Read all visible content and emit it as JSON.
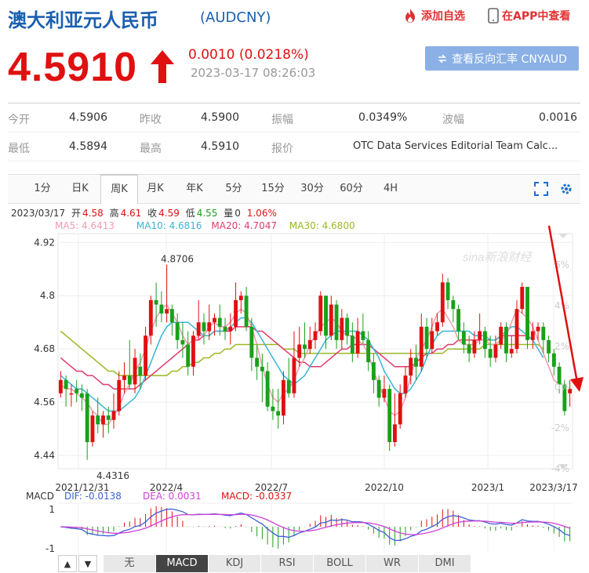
{
  "header": {
    "title": "澳大利亚元人民币",
    "code": "(AUDCNY)",
    "add_fav": "添加自选",
    "app_view": "在APP中查看",
    "price": "4.5910",
    "change": "0.0010 (0.0218%)",
    "time": "2023-03-17 08:26:03",
    "reverse_btn": "查看反向汇率 CNYAUD"
  },
  "info": {
    "row1": [
      {
        "label": "今开",
        "value": "4.5906"
      },
      {
        "label": "昨收",
        "value": "4.5900"
      },
      {
        "label": "振幅",
        "value": "0.0349%"
      },
      {
        "label": "波幅",
        "value": "0.0016"
      }
    ],
    "row2": [
      {
        "label": "最低",
        "value": "4.5894"
      },
      {
        "label": "最高",
        "value": "4.5910"
      },
      {
        "label": "报价",
        "value": "OTC Data Services Editorial Team Calc..."
      }
    ]
  },
  "tabs": [
    "1分",
    "日K",
    "周K",
    "月K",
    "年K",
    "5分",
    "15分",
    "30分",
    "60分",
    "4H"
  ],
  "active_tab": "周K",
  "legend": {
    "date": "2023/03/17",
    "open_label": "开",
    "open": "4.58",
    "high_label": "高",
    "high": "4.61",
    "close_label": "收",
    "close": "4.59",
    "low_label": "低",
    "low": "4.55",
    "vol_label": "量",
    "vol": "0",
    "pct": "1.06%",
    "ma5": "MA5: 4.6413",
    "ma10": "MA10: 4.6816",
    "ma20": "MA20: 4.7047",
    "ma30": "MA30: 4.6800"
  },
  "macd_legend": {
    "name": "MACD",
    "dif": "DIF: -0.0138",
    "dea": "DEA: 0.0031",
    "macd": "MACD: -0.0337"
  },
  "indicators": [
    "无",
    "MACD",
    "KDJ",
    "RSI",
    "BOLL",
    "WR",
    "DMI"
  ],
  "active_indicator": "MACD",
  "nav": {
    "up": "▲",
    "down": "▼"
  },
  "watermark": "sina新浪财经",
  "colors": {
    "up": "#e01010",
    "down": "#1aa01a",
    "ma5": "#f39ab0",
    "ma10": "#3ab4d8",
    "ma20": "#e03c6c",
    "ma30": "#9ab827",
    "dif": "#3b5fd6",
    "dea": "#d040d8"
  },
  "chart_data": {
    "type": "candlestick",
    "title": "",
    "y_ticks": [
      "4.92",
      "4.8",
      "4.68",
      "4.56",
      "4.44"
    ],
    "ylim": [
      4.41,
      4.94
    ],
    "pct_ticks": [
      "6%",
      "4%",
      "2%",
      "0%",
      "-2%",
      "-4%"
    ],
    "x_ticks": [
      "2021/12/31",
      "2022/4",
      "2022/7",
      "2022/10",
      "2023/1",
      "2023/3/17"
    ],
    "annotations": [
      {
        "text": "4.8706",
        "value": 4.8706
      },
      {
        "text": "4.4316",
        "value": 4.4316
      }
    ],
    "macd_y_ticks": [
      "1",
      "-1"
    ],
    "candles": [
      {
        "o": 4.58,
        "c": 4.61,
        "h": 4.63,
        "l": 4.57
      },
      {
        "o": 4.61,
        "c": 4.59,
        "h": 4.62,
        "l": 4.55
      },
      {
        "o": 4.58,
        "c": 4.58,
        "h": 4.6,
        "l": 4.55
      },
      {
        "o": 4.59,
        "c": 4.58,
        "h": 4.61,
        "l": 4.56
      },
      {
        "o": 4.58,
        "c": 4.57,
        "h": 4.6,
        "l": 4.54
      },
      {
        "o": 4.58,
        "c": 4.47,
        "h": 4.59,
        "l": 4.43
      },
      {
        "o": 4.47,
        "c": 4.53,
        "h": 4.54,
        "l": 4.46
      },
      {
        "o": 4.53,
        "c": 4.51,
        "h": 4.57,
        "l": 4.49
      },
      {
        "o": 4.51,
        "c": 4.53,
        "h": 4.54,
        "l": 4.48
      },
      {
        "o": 4.53,
        "c": 4.52,
        "h": 4.55,
        "l": 4.49
      },
      {
        "o": 4.52,
        "c": 4.54,
        "h": 4.58,
        "l": 4.5
      },
      {
        "o": 4.54,
        "c": 4.61,
        "h": 4.63,
        "l": 4.53
      },
      {
        "o": 4.61,
        "c": 4.62,
        "h": 4.65,
        "l": 4.58
      },
      {
        "o": 4.62,
        "c": 4.6,
        "h": 4.7,
        "l": 4.59
      },
      {
        "o": 4.6,
        "c": 4.66,
        "h": 4.68,
        "l": 4.58
      },
      {
        "o": 4.64,
        "c": 4.62,
        "h": 4.67,
        "l": 4.59
      },
      {
        "o": 4.62,
        "c": 4.71,
        "h": 4.73,
        "l": 4.61
      },
      {
        "o": 4.71,
        "c": 4.79,
        "h": 4.8,
        "l": 4.69
      },
      {
        "o": 4.79,
        "c": 4.78,
        "h": 4.83,
        "l": 4.73
      },
      {
        "o": 4.78,
        "c": 4.76,
        "h": 4.81,
        "l": 4.74
      },
      {
        "o": 4.76,
        "c": 4.77,
        "h": 4.87,
        "l": 4.74
      },
      {
        "o": 4.77,
        "c": 4.74,
        "h": 4.78,
        "l": 4.71
      },
      {
        "o": 4.74,
        "c": 4.7,
        "h": 4.76,
        "l": 4.68
      },
      {
        "o": 4.7,
        "c": 4.69,
        "h": 4.74,
        "l": 4.66
      },
      {
        "o": 4.69,
        "c": 4.64,
        "h": 4.72,
        "l": 4.62
      },
      {
        "o": 4.64,
        "c": 4.71,
        "h": 4.72,
        "l": 4.62
      },
      {
        "o": 4.71,
        "c": 4.74,
        "h": 4.79,
        "l": 4.7
      },
      {
        "o": 4.74,
        "c": 4.72,
        "h": 4.76,
        "l": 4.69
      },
      {
        "o": 4.72,
        "c": 4.74,
        "h": 4.78,
        "l": 4.7
      },
      {
        "o": 4.74,
        "c": 4.75,
        "h": 4.76,
        "l": 4.71
      },
      {
        "o": 4.75,
        "c": 4.73,
        "h": 4.78,
        "l": 4.71
      },
      {
        "o": 4.73,
        "c": 4.72,
        "h": 4.75,
        "l": 4.7
      },
      {
        "o": 4.72,
        "c": 4.73,
        "h": 4.76,
        "l": 4.69
      },
      {
        "o": 4.73,
        "c": 4.79,
        "h": 4.83,
        "l": 4.72
      },
      {
        "o": 4.79,
        "c": 4.8,
        "h": 4.81,
        "l": 4.76
      },
      {
        "o": 4.8,
        "c": 4.73,
        "h": 4.82,
        "l": 4.72
      },
      {
        "o": 4.73,
        "c": 4.66,
        "h": 4.75,
        "l": 4.63
      },
      {
        "o": 4.66,
        "c": 4.64,
        "h": 4.69,
        "l": 4.61
      },
      {
        "o": 4.64,
        "c": 4.63,
        "h": 4.67,
        "l": 4.56
      },
      {
        "o": 4.63,
        "c": 4.55,
        "h": 4.65,
        "l": 4.54
      },
      {
        "o": 4.55,
        "c": 4.54,
        "h": 4.59,
        "l": 4.52
      },
      {
        "o": 4.54,
        "c": 4.53,
        "h": 4.59,
        "l": 4.5
      },
      {
        "o": 4.53,
        "c": 4.61,
        "h": 4.63,
        "l": 4.51
      },
      {
        "o": 4.61,
        "c": 4.58,
        "h": 4.66,
        "l": 4.57
      },
      {
        "o": 4.58,
        "c": 4.66,
        "h": 4.72,
        "l": 4.57
      },
      {
        "o": 4.66,
        "c": 4.69,
        "h": 4.73,
        "l": 4.64
      },
      {
        "o": 4.69,
        "c": 4.68,
        "h": 4.74,
        "l": 4.66
      },
      {
        "o": 4.68,
        "c": 4.7,
        "h": 4.73,
        "l": 4.67
      },
      {
        "o": 4.7,
        "c": 4.72,
        "h": 4.74,
        "l": 4.68
      },
      {
        "o": 4.72,
        "c": 4.8,
        "h": 4.81,
        "l": 4.71
      },
      {
        "o": 4.8,
        "c": 4.71,
        "h": 4.8,
        "l": 4.68
      },
      {
        "o": 4.71,
        "c": 4.78,
        "h": 4.8,
        "l": 4.7
      },
      {
        "o": 4.78,
        "c": 4.7,
        "h": 4.79,
        "l": 4.68
      },
      {
        "o": 4.7,
        "c": 4.75,
        "h": 4.77,
        "l": 4.68
      },
      {
        "o": 4.75,
        "c": 4.71,
        "h": 4.76,
        "l": 4.69
      },
      {
        "o": 4.71,
        "c": 4.67,
        "h": 4.74,
        "l": 4.65
      },
      {
        "o": 4.67,
        "c": 4.72,
        "h": 4.75,
        "l": 4.66
      },
      {
        "o": 4.72,
        "c": 4.7,
        "h": 4.76,
        "l": 4.69
      },
      {
        "o": 4.7,
        "c": 4.65,
        "h": 4.72,
        "l": 4.63
      },
      {
        "o": 4.65,
        "c": 4.61,
        "h": 4.67,
        "l": 4.58
      },
      {
        "o": 4.61,
        "c": 4.57,
        "h": 4.62,
        "l": 4.55
      },
      {
        "o": 4.57,
        "c": 4.59,
        "h": 4.62,
        "l": 4.56
      },
      {
        "o": 4.59,
        "c": 4.47,
        "h": 4.6,
        "l": 4.45
      },
      {
        "o": 4.47,
        "c": 4.51,
        "h": 4.58,
        "l": 4.46
      },
      {
        "o": 4.51,
        "c": 4.58,
        "h": 4.6,
        "l": 4.5
      },
      {
        "o": 4.58,
        "c": 4.62,
        "h": 4.64,
        "l": 4.57
      },
      {
        "o": 4.62,
        "c": 4.66,
        "h": 4.68,
        "l": 4.6
      },
      {
        "o": 4.66,
        "c": 4.64,
        "h": 4.69,
        "l": 4.61
      },
      {
        "o": 4.64,
        "c": 4.73,
        "h": 4.76,
        "l": 4.63
      },
      {
        "o": 4.73,
        "c": 4.68,
        "h": 4.75,
        "l": 4.66
      },
      {
        "o": 4.68,
        "c": 4.72,
        "h": 4.75,
        "l": 4.67
      },
      {
        "o": 4.72,
        "c": 4.74,
        "h": 4.76,
        "l": 4.71
      },
      {
        "o": 4.74,
        "c": 4.83,
        "h": 4.85,
        "l": 4.73
      },
      {
        "o": 4.83,
        "c": 4.79,
        "h": 4.84,
        "l": 4.77
      },
      {
        "o": 4.79,
        "c": 4.77,
        "h": 4.8,
        "l": 4.74
      },
      {
        "o": 4.77,
        "c": 4.72,
        "h": 4.78,
        "l": 4.7
      },
      {
        "o": 4.72,
        "c": 4.69,
        "h": 4.74,
        "l": 4.67
      },
      {
        "o": 4.69,
        "c": 4.67,
        "h": 4.71,
        "l": 4.65
      },
      {
        "o": 4.67,
        "c": 4.7,
        "h": 4.72,
        "l": 4.66
      },
      {
        "o": 4.7,
        "c": 4.72,
        "h": 4.76,
        "l": 4.69
      },
      {
        "o": 4.72,
        "c": 4.68,
        "h": 4.73,
        "l": 4.66
      },
      {
        "o": 4.68,
        "c": 4.66,
        "h": 4.71,
        "l": 4.64
      },
      {
        "o": 4.66,
        "c": 4.69,
        "h": 4.71,
        "l": 4.65
      },
      {
        "o": 4.69,
        "c": 4.73,
        "h": 4.74,
        "l": 4.68
      },
      {
        "o": 4.73,
        "c": 4.67,
        "h": 4.74,
        "l": 4.65
      },
      {
        "o": 4.67,
        "c": 4.68,
        "h": 4.71,
        "l": 4.66
      },
      {
        "o": 4.68,
        "c": 4.77,
        "h": 4.79,
        "l": 4.67
      },
      {
        "o": 4.77,
        "c": 4.82,
        "h": 4.83,
        "l": 4.76
      },
      {
        "o": 4.82,
        "c": 4.7,
        "h": 4.82,
        "l": 4.68
      },
      {
        "o": 4.7,
        "c": 4.72,
        "h": 4.74,
        "l": 4.68
      },
      {
        "o": 4.72,
        "c": 4.73,
        "h": 4.74,
        "l": 4.7
      },
      {
        "o": 4.73,
        "c": 4.7,
        "h": 4.74,
        "l": 4.67
      },
      {
        "o": 4.7,
        "c": 4.67,
        "h": 4.71,
        "l": 4.65
      },
      {
        "o": 4.67,
        "c": 4.64,
        "h": 4.68,
        "l": 4.62
      },
      {
        "o": 4.64,
        "c": 4.6,
        "h": 4.65,
        "l": 4.58
      },
      {
        "o": 4.6,
        "c": 4.54,
        "h": 4.61,
        "l": 4.53
      },
      {
        "o": 4.58,
        "c": 4.59,
        "h": 4.61,
        "l": 4.55
      }
    ],
    "ma5": [
      4.6,
      4.59,
      4.59,
      4.58,
      4.57,
      4.56,
      4.54,
      4.53,
      4.51,
      4.51,
      4.53,
      4.55,
      4.58,
      4.6,
      4.63,
      4.65,
      4.68,
      4.72,
      4.75,
      4.77,
      4.78,
      4.76,
      4.74,
      4.71,
      4.69,
      4.7,
      4.71,
      4.71,
      4.73,
      4.74,
      4.73,
      4.73,
      4.74,
      4.76,
      4.77,
      4.76,
      4.73,
      4.69,
      4.64,
      4.6,
      4.57,
      4.56,
      4.58,
      4.59,
      4.61,
      4.64,
      4.66,
      4.69,
      4.71,
      4.73,
      4.74,
      4.75,
      4.74,
      4.72,
      4.71,
      4.71,
      4.7,
      4.69,
      4.67,
      4.63,
      4.6,
      4.57,
      4.54,
      4.53,
      4.54,
      4.57,
      4.62,
      4.66,
      4.68,
      4.7,
      4.73,
      4.76,
      4.77,
      4.75,
      4.73,
      4.7,
      4.69,
      4.69,
      4.69,
      4.7,
      4.7,
      4.69,
      4.69,
      4.7,
      4.71,
      4.74,
      4.77,
      4.76,
      4.75,
      4.73,
      4.7,
      4.67,
      4.64,
      4.61,
      4.6
    ],
    "ma10": [
      4.62,
      4.61,
      4.6,
      4.59,
      4.59,
      4.58,
      4.57,
      4.56,
      4.55,
      4.54,
      4.54,
      4.54,
      4.55,
      4.56,
      4.57,
      4.59,
      4.62,
      4.65,
      4.68,
      4.71,
      4.73,
      4.74,
      4.74,
      4.74,
      4.74,
      4.73,
      4.72,
      4.71,
      4.71,
      4.72,
      4.72,
      4.72,
      4.73,
      4.74,
      4.75,
      4.75,
      4.74,
      4.72,
      4.7,
      4.68,
      4.66,
      4.64,
      4.62,
      4.61,
      4.6,
      4.61,
      4.62,
      4.64,
      4.66,
      4.68,
      4.7,
      4.71,
      4.72,
      4.72,
      4.72,
      4.72,
      4.72,
      4.71,
      4.7,
      4.68,
      4.66,
      4.63,
      4.61,
      4.59,
      4.58,
      4.58,
      4.59,
      4.61,
      4.63,
      4.66,
      4.69,
      4.71,
      4.72,
      4.72,
      4.72,
      4.72,
      4.72,
      4.72,
      4.71,
      4.71,
      4.71,
      4.7,
      4.7,
      4.71,
      4.72,
      4.73,
      4.73,
      4.72,
      4.71,
      4.7,
      4.68,
      4.66
    ],
    "ma20": [
      4.66,
      4.65,
      4.64,
      4.63,
      4.63,
      4.62,
      4.62,
      4.61,
      4.6,
      4.6,
      4.59,
      4.59,
      4.59,
      4.59,
      4.59,
      4.6,
      4.61,
      4.62,
      4.63,
      4.64,
      4.65,
      4.66,
      4.67,
      4.68,
      4.69,
      4.7,
      4.7,
      4.71,
      4.71,
      4.72,
      4.72,
      4.72,
      4.72,
      4.73,
      4.73,
      4.73,
      4.73,
      4.72,
      4.72,
      4.71,
      4.7,
      4.69,
      4.68,
      4.67,
      4.66,
      4.65,
      4.65,
      4.64,
      4.64,
      4.64,
      4.65,
      4.66,
      4.67,
      4.68,
      4.68,
      4.69,
      4.69,
      4.69,
      4.69,
      4.68,
      4.67,
      4.66,
      4.65,
      4.64,
      4.64,
      4.64,
      4.64,
      4.65,
      4.66,
      4.67,
      4.67,
      4.68,
      4.68,
      4.69,
      4.69,
      4.7,
      4.7,
      4.7,
      4.7,
      4.7,
      4.7,
      4.7,
      4.7,
      4.71,
      4.71,
      4.71,
      4.71,
      4.71,
      4.71,
      4.7
    ],
    "ma30": [
      4.72,
      4.71,
      4.7,
      4.69,
      4.68,
      4.67,
      4.66,
      4.65,
      4.64,
      4.63,
      4.63,
      4.62,
      4.62,
      4.62,
      4.62,
      4.62,
      4.62,
      4.62,
      4.62,
      4.62,
      4.62,
      4.63,
      4.63,
      4.64,
      4.64,
      4.65,
      4.65,
      4.66,
      4.66,
      4.67,
      4.67,
      4.68,
      4.68,
      4.69,
      4.69,
      4.69,
      4.69,
      4.69,
      4.69,
      4.69,
      4.69,
      4.69,
      4.68,
      4.68,
      4.68,
      4.67,
      4.67,
      4.67,
      4.67,
      4.67,
      4.67,
      4.67,
      4.67,
      4.67,
      4.67,
      4.67,
      4.67,
      4.67,
      4.67,
      4.67,
      4.67,
      4.67,
      4.67,
      4.67,
      4.67,
      4.67,
      4.67,
      4.67,
      4.67,
      4.67,
      4.67,
      4.67,
      4.67,
      4.68,
      4.68,
      4.68,
      4.68,
      4.68,
      4.68,
      4.68,
      4.69,
      4.69,
      4.69,
      4.69,
      4.69,
      4.69,
      4.69,
      4.69,
      4.69,
      4.69,
      4.69,
      4.68
    ]
  }
}
